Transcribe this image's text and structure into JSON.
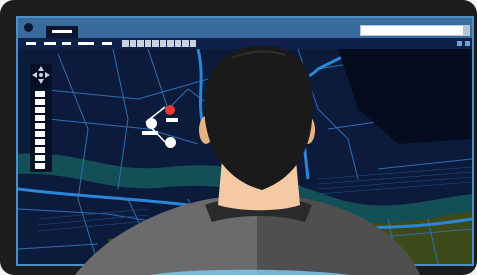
{
  "device": {
    "type": "laptop",
    "screen_content": "map application"
  },
  "map": {
    "land_color": "#0c1b3c",
    "road_color": "#2f6fb3",
    "major_road_color": "#2b86d6",
    "river_color": "#134f56",
    "park_color": "#3d4a1a"
  },
  "markers": {
    "selected_pin_color": "#e53935",
    "waypoint_pin_color": "#ffffff"
  },
  "icons": {
    "pan": "pan-arrows-icon",
    "zoom": "zoom-slider-icon"
  },
  "colors": {
    "bezel": "#1b1c1e",
    "titlebar": "#3a6b9d",
    "toolbar": "#0f214a",
    "hair": "#1a1a1a",
    "skin": "#f4c9a3",
    "jacket": "#6b6b6b"
  }
}
